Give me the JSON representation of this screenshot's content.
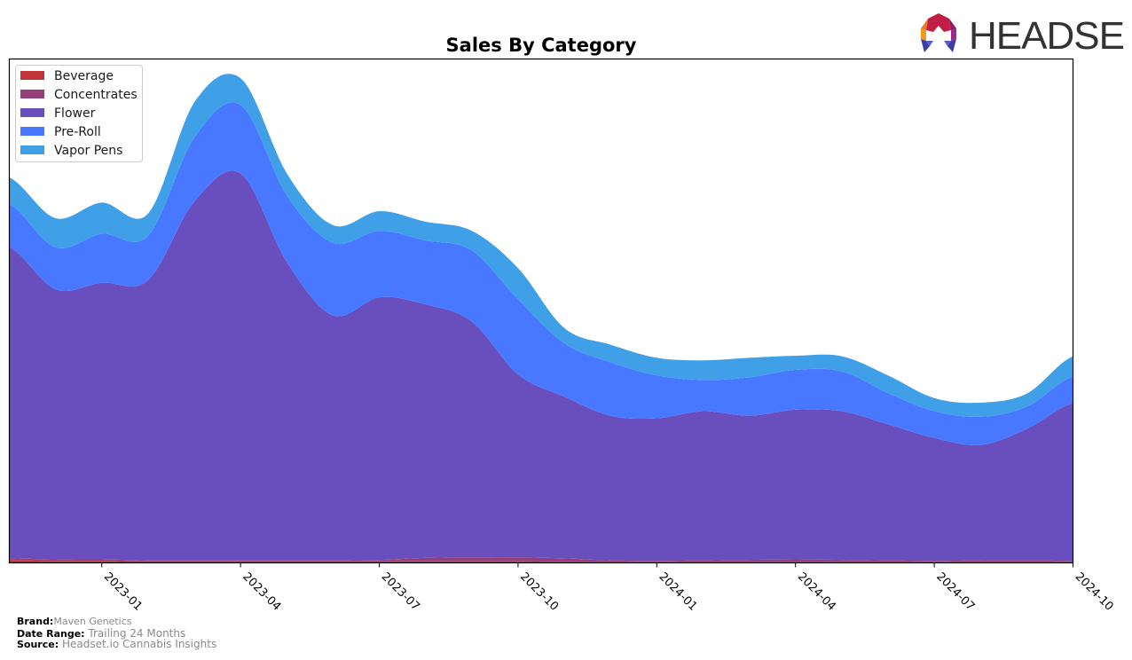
{
  "header": {
    "logo_text": "HEADSET"
  },
  "footer": {
    "brand_label": "Brand:",
    "brand_value": "Maven Genetics",
    "date_range_label": "Date Range:",
    "date_range_value": "Trailing 24 Months",
    "source_label": "Source:",
    "source_value": "Headset.io Cannabis Insights"
  },
  "chart_data": {
    "type": "area",
    "stacked": true,
    "title": "Sales By Category",
    "xlabel": "",
    "ylabel": "",
    "y_ticks_shown": false,
    "ylim": [
      0,
      100
    ],
    "grid": false,
    "legend_position": "top-left",
    "x": [
      "2022-11",
      "2022-12",
      "2023-01",
      "2023-02",
      "2023-03",
      "2023-04",
      "2023-05",
      "2023-06",
      "2023-07",
      "2023-08",
      "2023-09",
      "2023-10",
      "2023-11",
      "2023-12",
      "2024-01",
      "2024-02",
      "2024-03",
      "2024-04",
      "2024-05",
      "2024-06",
      "2024-07",
      "2024-08",
      "2024-09",
      "2024-10"
    ],
    "x_ticks": [
      "2023-01",
      "2023-04",
      "2023-07",
      "2023-10",
      "2024-01",
      "2024-04",
      "2024-07",
      "2024-10"
    ],
    "series": [
      {
        "name": "Beverage",
        "color": "#c0343a",
        "values": [
          0.5,
          0.4,
          0.4,
          0.3,
          0.3,
          0.3,
          0.3,
          0.3,
          0.3,
          0.3,
          0.3,
          0.3,
          0.2,
          0.2,
          0.2,
          0.2,
          0.2,
          0.2,
          0.2,
          0.2,
          0.2,
          0.2,
          0.2,
          0.2
        ]
      },
      {
        "name": "Concentrates",
        "color": "#953f7b",
        "values": [
          0.4,
          0.3,
          0.3,
          0.2,
          0.2,
          0.2,
          0.2,
          0.2,
          0.3,
          0.7,
          0.8,
          0.8,
          0.7,
          0.3,
          0.2,
          0.3,
          0.4,
          0.5,
          0.4,
          0.3,
          0.2,
          0.3,
          0.3,
          0.2
        ]
      },
      {
        "name": "Flower",
        "color": "#684fbd",
        "values": [
          61.8,
          53.6,
          54.9,
          55.6,
          71.2,
          76.8,
          59.2,
          48.6,
          52.1,
          50.3,
          46.8,
          36.3,
          32.1,
          28.7,
          28.3,
          29.6,
          28.6,
          29.7,
          29.5,
          27.0,
          24.4,
          22.9,
          26.1,
          31.3
        ]
      },
      {
        "name": "Pre-Roll",
        "color": "#4778ff",
        "values": [
          8.5,
          8.3,
          9.7,
          8.8,
          12.7,
          13.6,
          13.2,
          14.4,
          13.2,
          12.7,
          14.1,
          14.9,
          10.6,
          10.6,
          8.5,
          6.2,
          7.6,
          7.9,
          7.9,
          6.2,
          5.3,
          5.6,
          4.4,
          5.3
        ]
      },
      {
        "name": "Vapor Pens",
        "color": "#3fa0e8",
        "values": [
          5.3,
          5.8,
          6.2,
          4.4,
          7.0,
          5.3,
          4.4,
          3.5,
          3.9,
          3.7,
          3.9,
          6.2,
          3.0,
          3.5,
          3.5,
          3.9,
          3.9,
          2.8,
          3.0,
          3.5,
          2.6,
          2.8,
          2.6,
          4.0
        ]
      }
    ]
  }
}
